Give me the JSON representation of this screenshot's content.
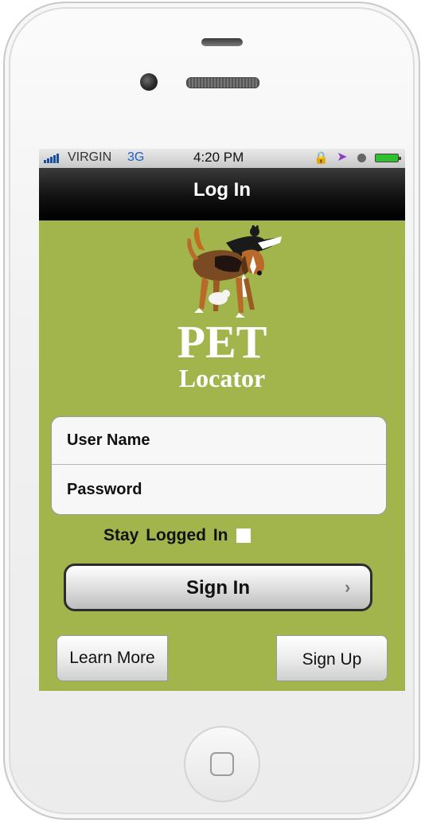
{
  "status_bar": {
    "carrier": "VIRGIN",
    "network": "3G",
    "time": "4:20 PM",
    "icons": [
      "signal-icon",
      "lock-rotation-icon",
      "location-icon",
      "alarm-icon",
      "battery-icon"
    ]
  },
  "nav": {
    "title": "Log In"
  },
  "logo": {
    "line1": "PET",
    "line2": "Locator",
    "image": "dog-and-cat-icon"
  },
  "form": {
    "username_placeholder": "User Name",
    "password_placeholder": "Password",
    "stay_logged_in_label": "Stay Logged  In",
    "stay_logged_in_checked": false
  },
  "buttons": {
    "sign_in": "Sign In",
    "learn_more": "Learn More",
    "sign_up": "Sign Up"
  },
  "colors": {
    "screen_background": "#a2b54c",
    "nav_background": "#000000",
    "carrier_network": "#1f5fc8"
  }
}
